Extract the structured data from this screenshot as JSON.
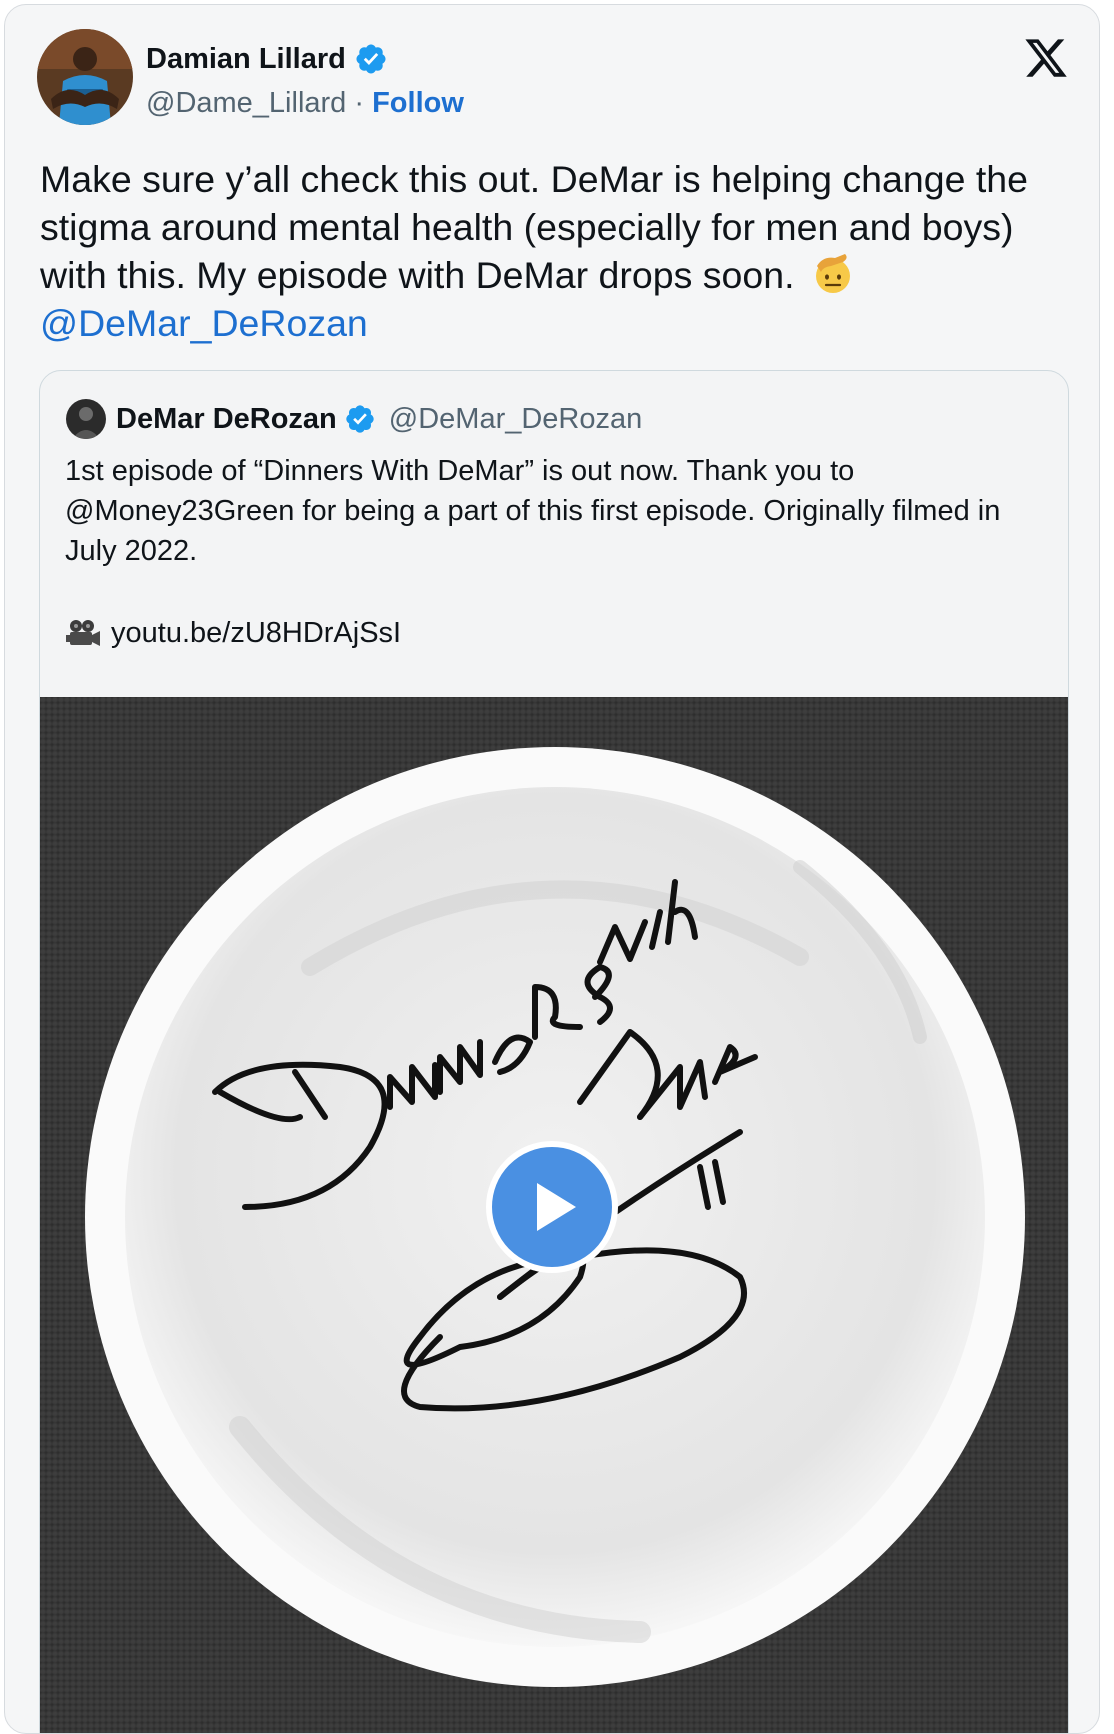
{
  "author": {
    "display_name": "Damian Lillard",
    "handle": "@Dame_Lillard",
    "separator": " · ",
    "follow_label": "Follow",
    "verified": true
  },
  "tweet": {
    "text": "Make sure y’all check this out. DeMar is helping change the stigma around mental health (especially for men and boys) with this. My episode with DeMar drops soon.",
    "emoji": "saluting-face",
    "mention": "@DeMar_DeRozan"
  },
  "quoted_tweet": {
    "display_name": "DeMar DeRozan",
    "handle": "@DeMar_DeRozan",
    "verified": true,
    "text": "1st episode of “Dinners With DeMar” is out now. Thank you to @Money23Green for being a part of this first episode. Originally filmed in July 2022.",
    "link_icon": "movie-camera-icon",
    "link": "youtu.be/zU8HDrAjSsI",
    "media": {
      "type": "video",
      "artwork": "Dinners with DeMar",
      "play_icon": "play-icon"
    }
  },
  "colors": {
    "link_blue": "#1d6fd0",
    "verified_blue": "#1d9bf0",
    "play_blue": "#4a90e2",
    "secondary_text": "#536471"
  },
  "platform_logo": "x-logo-icon"
}
